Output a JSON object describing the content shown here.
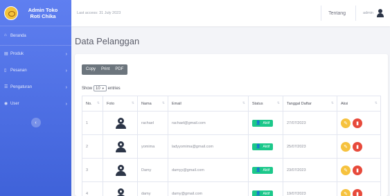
{
  "sidebar": {
    "brand": "Admin Toko Roti Chika",
    "items": [
      {
        "label": "Beranda",
        "icon": "home-icon",
        "has_arrow": false
      },
      {
        "label": "Produk",
        "icon": "box-icon",
        "has_arrow": true
      },
      {
        "label": "Pesanan",
        "icon": "receipt-icon",
        "has_arrow": true
      },
      {
        "label": "Pengaturan",
        "icon": "settings-icon",
        "has_arrow": true
      },
      {
        "label": "User",
        "icon": "user-icon",
        "has_arrow": true
      }
    ],
    "toggle_icon": "chevron-left-icon"
  },
  "topbar": {
    "last_access": "Last access: 31 July 2023",
    "link": "Tentang",
    "user_name": "admin"
  },
  "page": {
    "title": "Data Pelanggan"
  },
  "table_controls": {
    "buttons": [
      "Copy",
      "Print",
      "PDF"
    ],
    "show_label": "Show",
    "entries_value": "10",
    "entries_label": "entries"
  },
  "table": {
    "headers": [
      "No.",
      "Foto",
      "Nama",
      "Email",
      "Status",
      "Tanggal Daftar",
      "Aksi"
    ],
    "rows": [
      {
        "no": "1",
        "nama": "rachael",
        "email": "rachael@gmail.com",
        "status": "Aktif",
        "tanggal": "27/07/2023"
      },
      {
        "no": "2",
        "nama": "yomima",
        "email": "ladyyomima@gmail.com",
        "status": "Aktif",
        "tanggal": "25/07/2023"
      },
      {
        "no": "3",
        "nama": "Damy",
        "email": "damyy@gmail.com",
        "status": "Aktif",
        "tanggal": "23/07/2023"
      },
      {
        "no": "4",
        "nama": "damy",
        "email": "damy@gmail.com",
        "status": "Aktif",
        "tanggal": "19/07/2023"
      }
    ]
  },
  "colors": {
    "sidebar_start": "#5f7ff0",
    "sidebar_end": "#3f62d9",
    "status_active": "#1cc88a",
    "edit": "#f6c23e",
    "delete": "#e74a3b"
  }
}
